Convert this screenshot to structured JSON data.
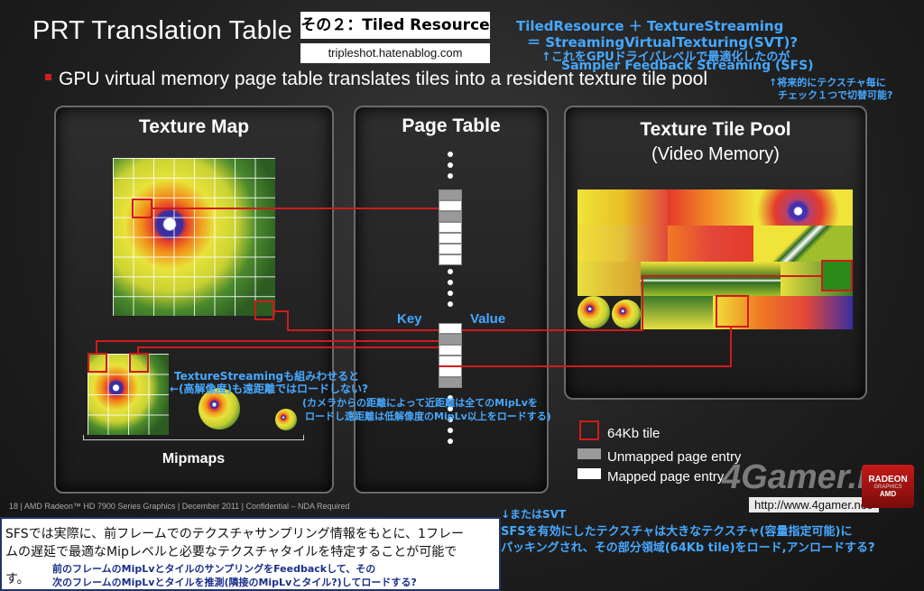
{
  "header": {
    "title": "PRT Translation Table",
    "badge": "その２：Tiled Resource",
    "blog": "tripleshot.hatenablog.com"
  },
  "annotations": {
    "top_right_1": "TiledResource ＋ TextureStreaming",
    "top_right_2": "＝ StreamingVirtualTexturing(SVT)?",
    "top_right_3": "↑これをGPUドライバレベルで最適化したのが",
    "top_right_4": "Sampler Feedback Streaming (SFS)",
    "side_1": "↑将来的にテクスチャ毎に",
    "side_2": "チェック１つで切替可能?",
    "mid_1": "TextureStreamingも組みわせると",
    "mid_2": "←(高解像度)も遠距離ではロードしない?",
    "mid_3": "(カメラからの距離によって近距離は全てのMipLvを",
    "mid_4": "ロードし遠距離は低解像度のMipLv以上をロードする)",
    "svt_1": "↓またはSVT",
    "svt_2": "SFSを有効にしたテクスチャは大きなテクスチャ(容量指定可能)に",
    "svt_3": "パッキングされ、その部分領域(64Kb tile)をロード,アンロードする?"
  },
  "bullet": "GPU virtual memory page table translates tiles into a resident texture tile pool",
  "panels": {
    "texture_map": "Texture Map",
    "mipmaps": "Mipmaps",
    "page_table": "Page Table",
    "key": "Key",
    "value": "Value",
    "tile_pool_title": "Texture Tile Pool",
    "tile_pool_sub": "(Video Memory)"
  },
  "legend": {
    "tile": "64Kb tile",
    "unmapped": "Unmapped page entry",
    "mapped": "Mapped page entry"
  },
  "footer": "18 | AMD Radeon™ HD 7900 Series Graphics | December 2011 | Confidential – NDA Required",
  "watermark": {
    "logo": "4Gamer.net",
    "url": "http://www.4gamer.net/",
    "radeon": "RADEON",
    "radeon_sub": "GRAPHICS",
    "amd": "AMD"
  },
  "note": {
    "line1": "SFSでは実際に、前フレームでのテクスチャサンプリング情報をもとに、1フレー",
    "line2": "ムの遅延で最適なMipレベルと必要なテクスチャタイルを特定することが可能で",
    "line3": "す。",
    "sub1": "前のフレームのMipLvとタイルのサンプリングをFeedbackして、その",
    "sub2": "次のフレームのMipLvとタイルを推測(隣接のMipLvとタイル?)してロードする?"
  },
  "colors": {
    "accent_red": "#d01b1b",
    "annotation_blue": "#46a8ff",
    "note_blue": "#1a2f8c"
  }
}
